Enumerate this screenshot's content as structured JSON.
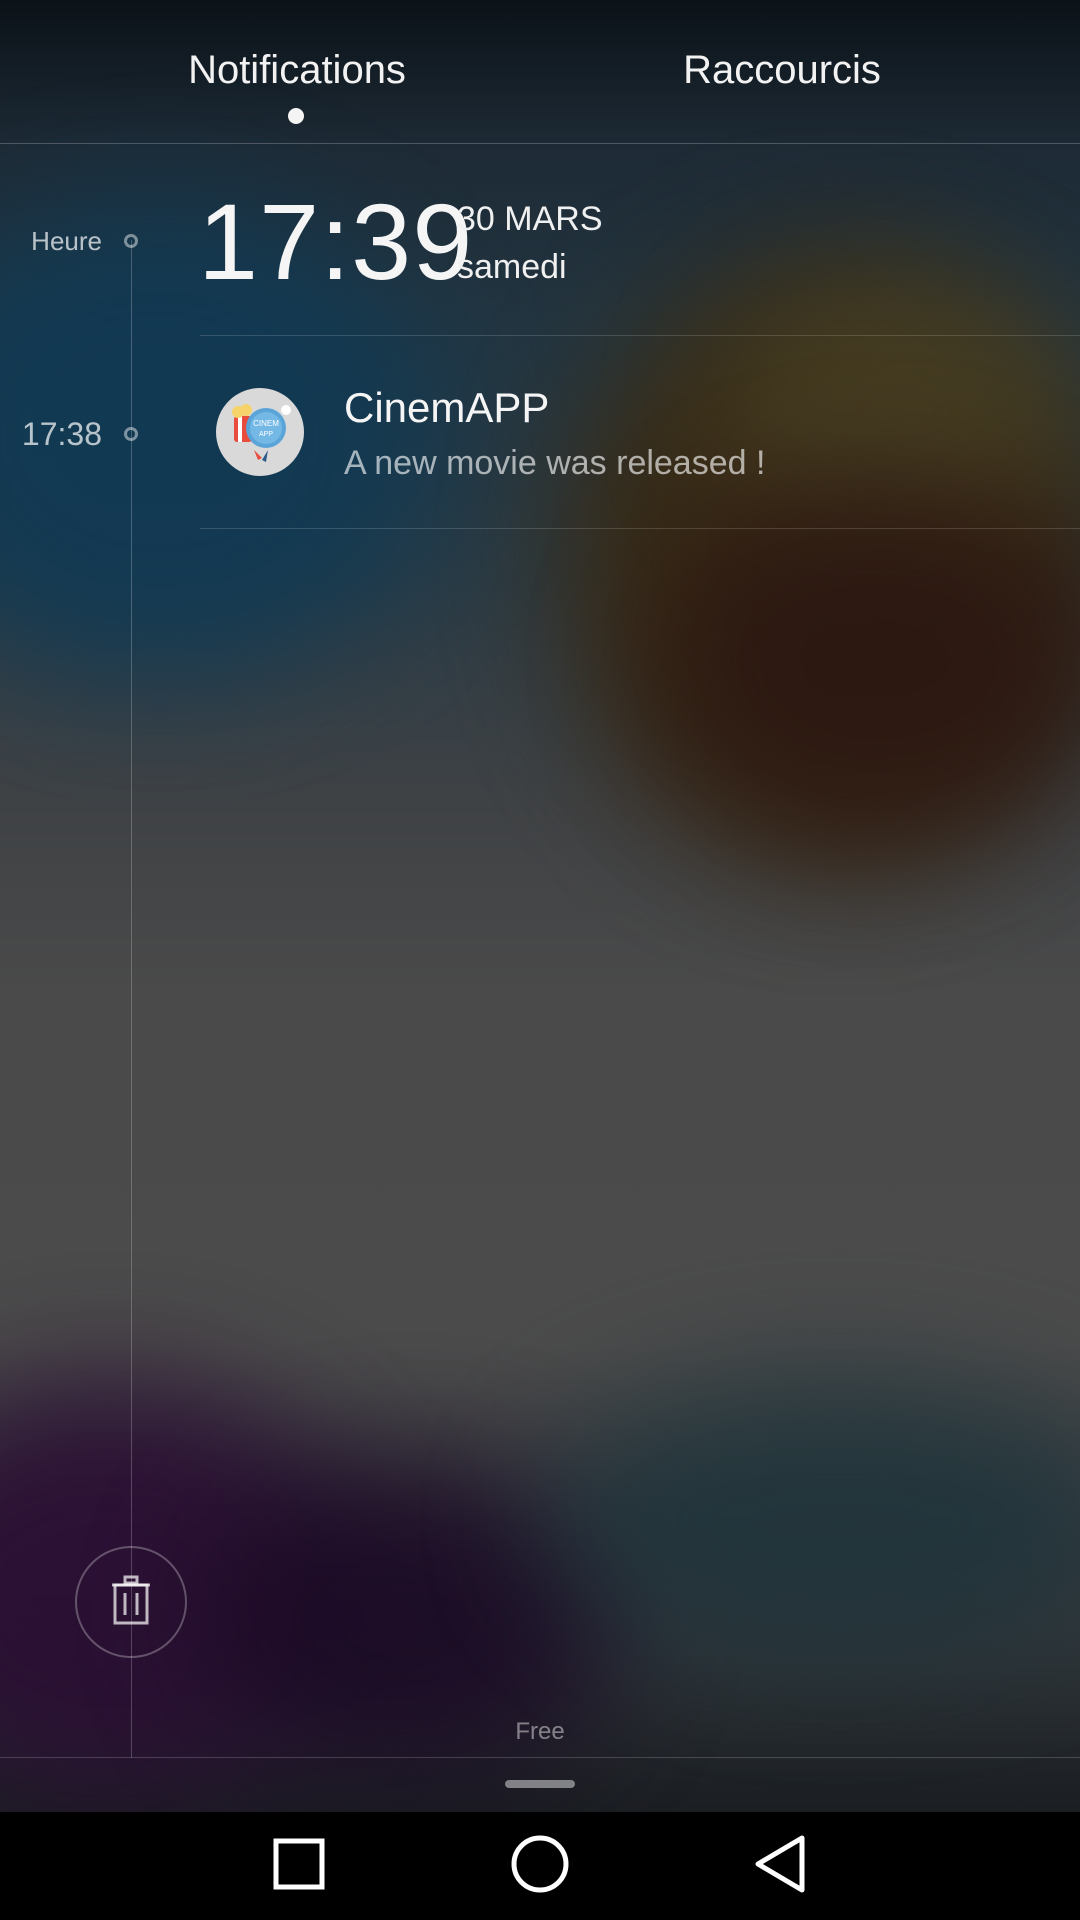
{
  "tabs": [
    {
      "label": "Notifications",
      "active": true
    },
    {
      "label": "Raccourcis",
      "active": false
    }
  ],
  "clock": {
    "label": "Heure",
    "time": "17:39",
    "date": "30 MARS",
    "day": "samedi"
  },
  "notifications": [
    {
      "time": "17:38",
      "app": "CinemAPP",
      "message": "A new movie was released !",
      "icon": "cinemapp-logo",
      "icon_text": "CINEM APP"
    }
  ],
  "trash": {
    "icon": "trash-icon"
  },
  "carrier": "Free",
  "navbar": {
    "icons": [
      "recents-square-icon",
      "home-circle-icon",
      "back-triangle-icon"
    ]
  },
  "colors": {
    "nav_background": "#000000",
    "text_primary": "#f5f5f5",
    "app_icon_bg": "#d9d9d9"
  }
}
